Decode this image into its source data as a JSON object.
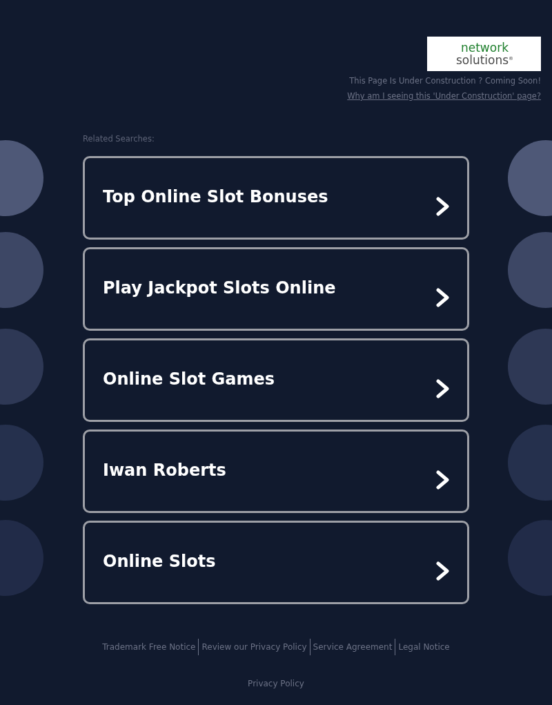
{
  "header": {
    "logo": {
      "line_1": "network",
      "line_2": "solutions$^{®}$"
    },
    "notice": "This Page Is Under Construction ? Coming Soon!",
    "info_link": "Why am I seeing this 'Under Construction' page?"
  },
  "related_searches": {
    "heading": "Related Searches:",
    "links": [
      "Top Online Slot Bonuses",
      "Play Jackpot Slots Online",
      "Online Slot Games",
      "Iwan Roberts",
      "Online Slots"
    ]
  },
  "footer": {
    "links": [
      "Trademark Free Notice",
      "Review our Privacy Policy",
      "Service Agreement",
      "Legal Notice"
    ],
    "privacy_link": "Privacy Policy"
  }
}
